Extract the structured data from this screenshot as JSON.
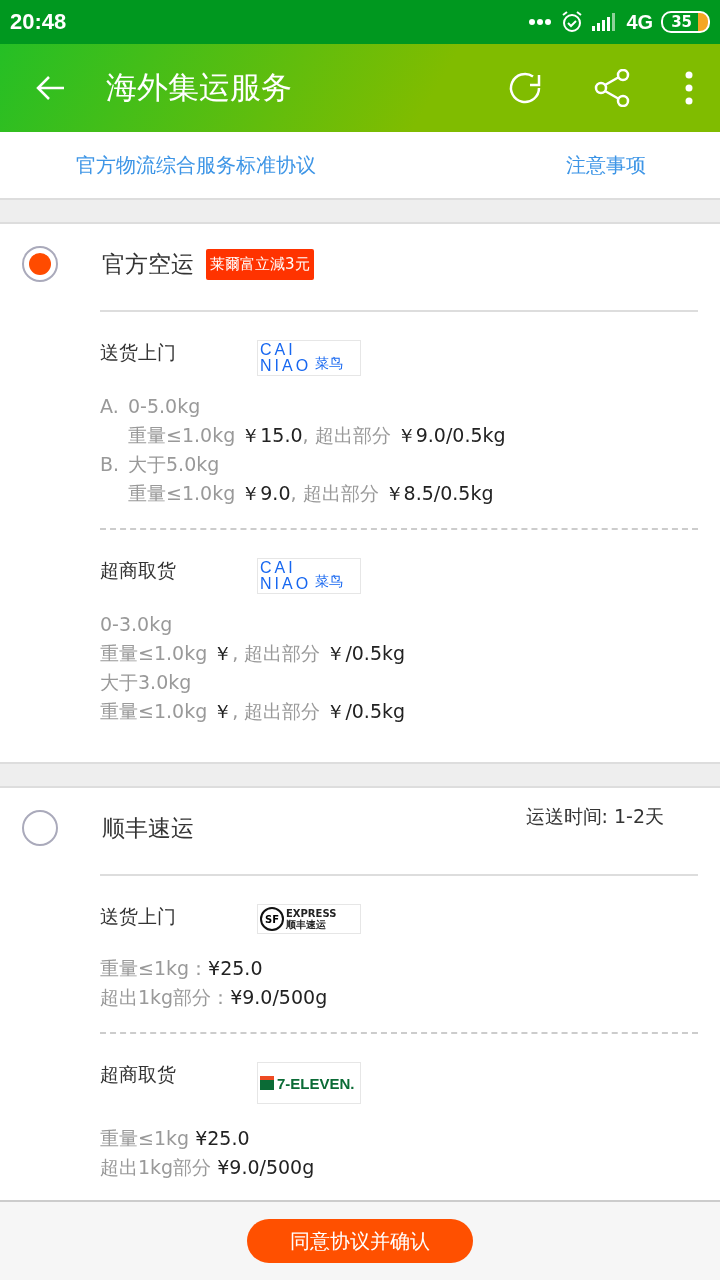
{
  "status_bar": {
    "time": "20:48",
    "network": "4G",
    "battery": "35"
  },
  "app_bar": {
    "title": "海外集运服务"
  },
  "links": [
    "官方物流综合服务标准协议",
    "注意事项"
  ],
  "sections": [
    {
      "name": "官方空运",
      "selected": true,
      "badge": "莱爾富立減3元",
      "methods": [
        {
          "label": "送货上门",
          "logo": {
            "kind": "cainiao",
            "lines": [
              "CAI",
              "NIAO"
            ],
            "sub": "菜鸟"
          },
          "tiers": [
            {
              "marker": "A.",
              "range": "0-5.0kg",
              "prices": [
                [
                  {
                    "text": "重量≤1.0kg ",
                    "dark": false
                  },
                  {
                    "text": "￥15.0",
                    "dark": true
                  },
                  {
                    "text": ", 超出部分 ",
                    "dark": false
                  },
                  {
                    "text": "￥9.0/0.5kg",
                    "dark": true
                  }
                ]
              ]
            },
            {
              "marker": "B.",
              "range": "大于5.0kg",
              "prices": [
                [
                  {
                    "text": "重量≤1.0kg ",
                    "dark": false
                  },
                  {
                    "text": "￥9.0",
                    "dark": true
                  },
                  {
                    "text": ", 超出部分 ",
                    "dark": false
                  },
                  {
                    "text": "￥8.5/0.5kg",
                    "dark": true
                  }
                ]
              ]
            }
          ]
        },
        {
          "label": "超商取货",
          "logo": {
            "kind": "cainiao",
            "lines": [
              "CAI",
              "NIAO"
            ],
            "sub": "菜鸟"
          },
          "tiers": [
            {
              "range": "0-3.0kg",
              "prices": [
                [
                  {
                    "text": "重量≤1.0kg ",
                    "dark": false
                  },
                  {
                    "text": "￥",
                    "dark": true
                  },
                  {
                    "text": ", 超出部分 ",
                    "dark": false
                  },
                  {
                    "text": "￥/0.5kg",
                    "dark": true
                  }
                ]
              ]
            },
            {
              "range": "大于3.0kg",
              "prices": [
                [
                  {
                    "text": "重量≤1.0kg ",
                    "dark": false
                  },
                  {
                    "text": "￥",
                    "dark": true
                  },
                  {
                    "text": ", 超出部分 ",
                    "dark": false
                  },
                  {
                    "text": "￥/0.5kg",
                    "dark": true
                  }
                ]
              ]
            }
          ]
        }
      ]
    },
    {
      "name": "顺丰速运",
      "selected": false,
      "delivery_time": "运送时间: 1-2天",
      "methods": [
        {
          "label": "送货上门",
          "logo": {
            "kind": "sf",
            "lines": [
              "SF"
            ],
            "sub": "EXPRESS",
            "sub2": "顺丰速运"
          },
          "tiers": [
            {
              "prices": [
                [
                  {
                    "text": "重量≤1kg：",
                    "dark": false
                  },
                  {
                    "text": "¥25.0",
                    "dark": true
                  }
                ],
                [
                  {
                    "text": "超出1kg部分：",
                    "dark": false
                  },
                  {
                    "text": "¥9.0/500g",
                    "dark": true
                  }
                ]
              ]
            }
          ]
        },
        {
          "label": "超商取货",
          "logo": {
            "kind": "seven",
            "lines": [
              "7-ELEVEN."
            ]
          },
          "tiers": [
            {
              "prices": [
                [
                  {
                    "text": "重量≤1kg ",
                    "dark": false
                  },
                  {
                    "text": "¥25.0",
                    "dark": true
                  }
                ],
                [
                  {
                    "text": "超出1kg部分 ",
                    "dark": false
                  },
                  {
                    "text": "¥9.0/500g",
                    "dark": true
                  }
                ]
              ]
            }
          ]
        }
      ]
    }
  ],
  "confirm_button": "同意协议并确认"
}
